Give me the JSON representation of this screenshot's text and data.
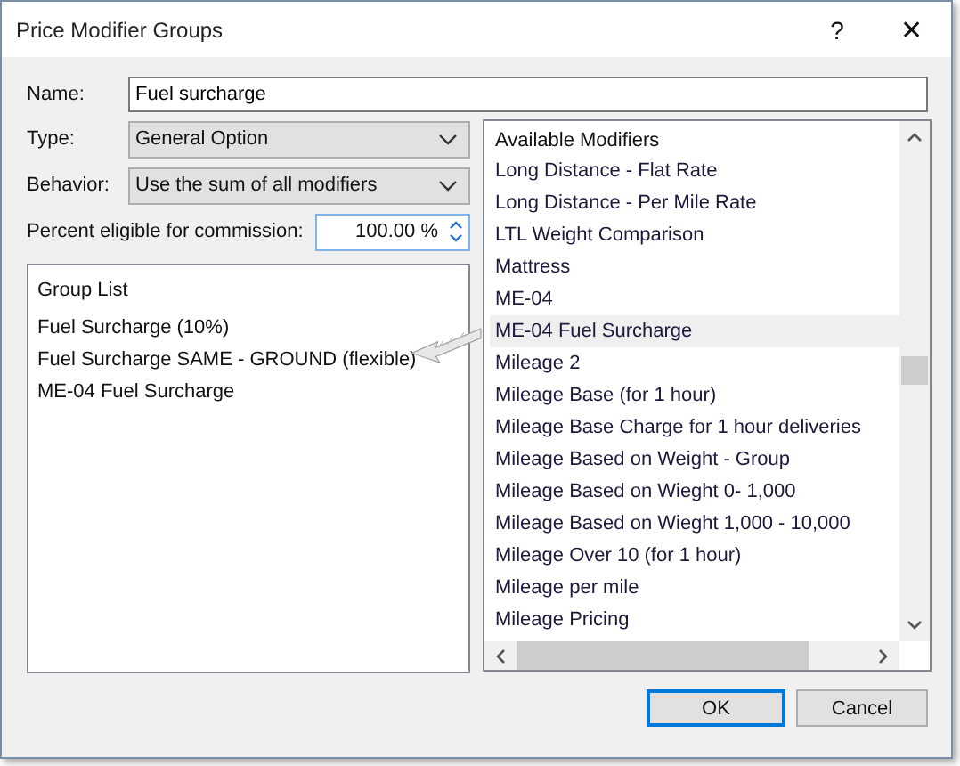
{
  "window": {
    "title": "Price Modifier Groups",
    "help": "?",
    "close": "✕"
  },
  "name_field": {
    "label": "Name:",
    "value": "Fuel surcharge"
  },
  "type_field": {
    "label": "Type:",
    "value": "General Option"
  },
  "behavior_field": {
    "label": "Behavior:",
    "value": "Use the sum of all modifiers"
  },
  "commission_field": {
    "label": "Percent eligible for commission:",
    "value": "100.00 %"
  },
  "group_list": {
    "heading": "Group List",
    "items": [
      "Fuel Surcharge (10%)",
      "Fuel Surcharge SAME - GROUND (flexible)",
      "ME-04 Fuel Surcharge"
    ]
  },
  "available_modifiers": {
    "heading": "Available Modifiers",
    "items": [
      {
        "label": "Long Distance - Flat Rate",
        "selected": false
      },
      {
        "label": "Long Distance - Per Mile Rate",
        "selected": false
      },
      {
        "label": "LTL Weight Comparison",
        "selected": false
      },
      {
        "label": "Mattress",
        "selected": false
      },
      {
        "label": "ME-04",
        "selected": false
      },
      {
        "label": "ME-04 Fuel Surcharge",
        "selected": true
      },
      {
        "label": "Mileage 2",
        "selected": false
      },
      {
        "label": "Mileage Base (for 1 hour)",
        "selected": false
      },
      {
        "label": "Mileage Base Charge for 1 hour deliveries",
        "selected": false
      },
      {
        "label": "Mileage Based on Weight - Group",
        "selected": false
      },
      {
        "label": "Mileage Based on Wieght  0- 1,000",
        "selected": false
      },
      {
        "label": "Mileage Based on Wieght 1,000 - 10,000",
        "selected": false
      },
      {
        "label": "Mileage Over 10 (for 1 hour)",
        "selected": false
      },
      {
        "label": "Mileage per mile",
        "selected": false
      },
      {
        "label": "Mileage Pricing",
        "selected": false
      }
    ]
  },
  "buttons": [
    {
      "label": "OK",
      "default": true
    },
    {
      "label": "Cancel",
      "default": false
    }
  ]
}
